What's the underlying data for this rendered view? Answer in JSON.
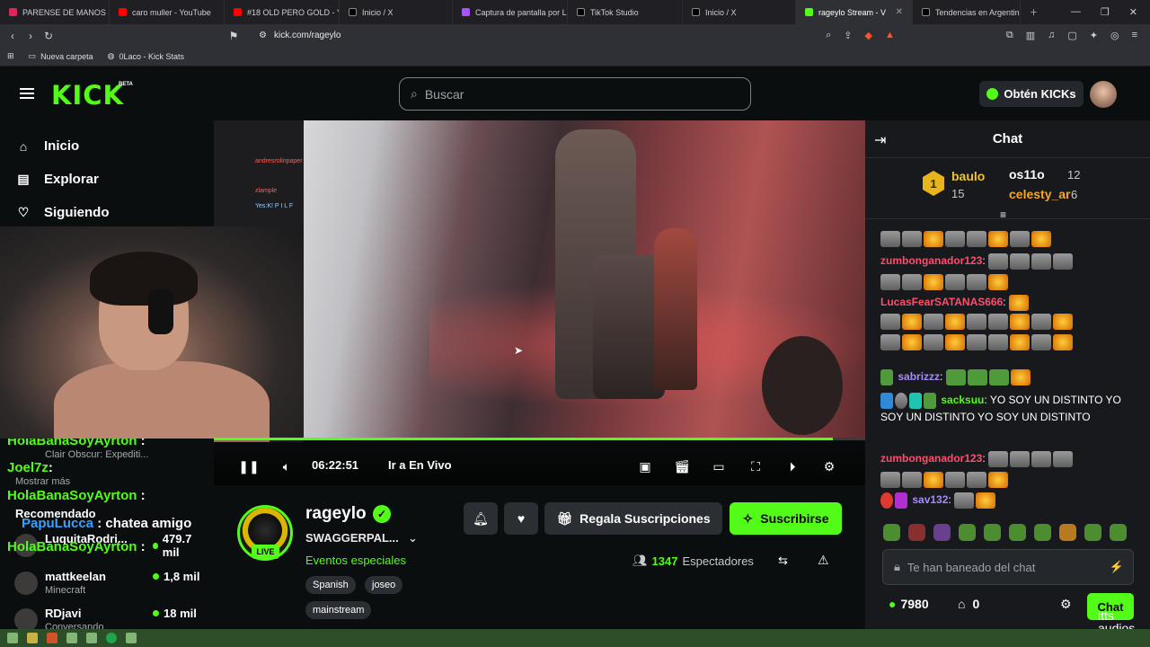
{
  "browser": {
    "tabs": [
      {
        "label": "PARENSE DE MANOS 3 - E",
        "color": "#e0245e"
      },
      {
        "label": "caro muller - YouTube",
        "color": "#ff0000"
      },
      {
        "label": "#18 OLD PERO GOLD - Yo",
        "color": "#ff0000"
      },
      {
        "label": "Inicio / X",
        "color": "#ffffff"
      },
      {
        "label": "Captura de pantalla por Li",
        "color": "#a855f7"
      },
      {
        "label": "TikTok Studio",
        "color": "#ffffff"
      },
      {
        "label": "Inicio / X",
        "color": "#ffffff"
      },
      {
        "label": "rageylo Stream - V",
        "color": "#53fc18"
      },
      {
        "label": "Tendencias en Argentina",
        "color": "#ffffff"
      }
    ],
    "url": "kick.com/rageylo",
    "bookmarks": [
      "Nueva carpeta",
      "0Laco - Kick Stats"
    ]
  },
  "header": {
    "logo": "KICK",
    "logo_badge": "BETA",
    "search_placeholder": "Buscar",
    "kicks_button": "Obtén KICKs"
  },
  "sidebar": {
    "items": [
      {
        "label": "Inicio",
        "icon": "home-icon"
      },
      {
        "label": "Explorar",
        "icon": "explore-icon"
      },
      {
        "label": "Siguiendo",
        "icon": "heart-icon"
      }
    ]
  },
  "overlay_chat": {
    "lines": [
      "andresrolinpaper",
      "zlample",
      "Yes:K! P I L F"
    ]
  },
  "lower_left": {
    "chat_lines": [
      {
        "user": "HolaBanaSoyAyrton",
        "text": ":",
        "color": "#53fc18"
      },
      {
        "user": "Joel7z",
        "text": ":",
        "color": "#53fc18"
      },
      {
        "user": "HolaBanaSoyAyrton",
        "text": ":",
        "color": "#53fc18"
      },
      {
        "user": "PapuLucca",
        "text": ": chatea amigo",
        "color": "#3aa0ff"
      },
      {
        "user": "HolaBanaSoyAyrton",
        "text": ":",
        "color": "#53fc18"
      }
    ],
    "show_more": "Mostrar más",
    "recommended_label": "Recomendado",
    "clair_label": "Clair Obscur: Expediti...",
    "recommended": [
      {
        "name": "LuquitaRodri...",
        "category": "",
        "viewers": "479.7 mil"
      },
      {
        "name": "mattkeelan",
        "category": "Minecraft",
        "viewers": "1,8 mil"
      },
      {
        "name": "RDjavi",
        "category": "Conversando",
        "viewers": "18 mil"
      }
    ]
  },
  "player": {
    "time": "06:22:51",
    "go_live": "Ir a En Vivo",
    "progress": 0.95
  },
  "stream": {
    "name": "rageylo",
    "title": "SWAGGERPAL...",
    "category": "Eventos especiales",
    "live_badge": "LIVE",
    "tags": [
      "Spanish",
      "joseo",
      "mainstream"
    ],
    "gift_button": "Regala Suscripciones",
    "subscribe_button": "Suscribirse",
    "viewers_count": "1347",
    "viewers_label": "Espectadores"
  },
  "chat": {
    "title": "Chat",
    "leaderboard": [
      {
        "name": "baulo",
        "count": "15",
        "rank": "1"
      },
      {
        "name": "os11o",
        "count": "12"
      },
      {
        "name": "celesty_ar",
        "count": "6"
      }
    ],
    "messages": [
      {
        "user": "zumbonganador123",
        "text": ":",
        "color": "#ff4d6d"
      },
      {
        "user": "LucasFearSATANAS666",
        "text": ":",
        "color": "#ff4d6d"
      },
      {
        "user": "sabrizzz",
        "text": ":",
        "color": "#a78bfa"
      },
      {
        "user": "sacksuu",
        "text": ": YO SOY UN DISTINTO YO SOY UN DISTINTO YO SOY UN DISTINTO",
        "color": "#53fc18"
      },
      {
        "user": "zumbonganador123",
        "text": ":",
        "color": "#ff4d6d"
      },
      {
        "user": "sav132",
        "text": ":",
        "color": "#a78bfa"
      }
    ],
    "input_placeholder": "Te han baneado del chat",
    "kicks_balance": "7980",
    "store_count": "0",
    "send_button": "Chat"
  },
  "watermark": "itts\naudios"
}
